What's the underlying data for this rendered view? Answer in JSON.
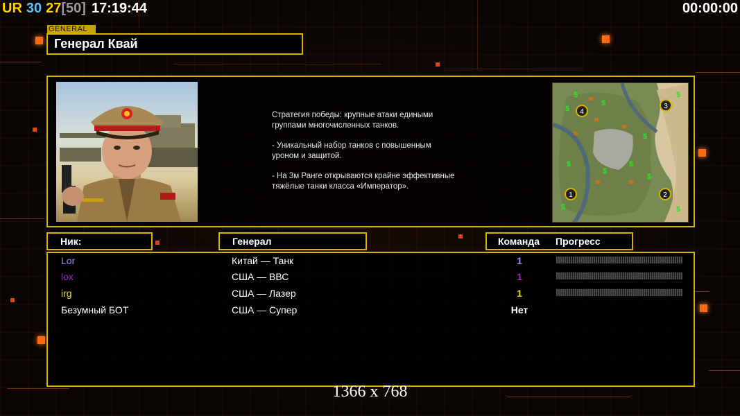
{
  "hud": {
    "ur_label": "UR",
    "stat1": "30",
    "stat2": "27",
    "stat3": "[50]",
    "clock": "17:19:44",
    "timer": "00:00:00"
  },
  "header": {
    "tag": "GENERAL",
    "title": "Генерал Квай"
  },
  "info": {
    "description": "Стратегия победы: крупные атаки едиными\n группами многочисленных танков.\n\n- Уникальный набор танков с повышенным\n уроном и защитой.\n\n- На 3м Ранге открываются крайне эффективные\n тяжёлые танки класса «Император».",
    "minimap_slots": [
      "1",
      "2",
      "3",
      "4"
    ]
  },
  "columns": {
    "nick": "Ник:",
    "general": "Генерал",
    "team": "Команда",
    "progress": "Прогресс"
  },
  "players": [
    {
      "nick": "Lor",
      "general": "Китай — Танк",
      "team": "1",
      "color": "#8c8cff",
      "team_color": "#8c8cff",
      "progress": 0
    },
    {
      "nick": "lox",
      "general": "США — ВВС",
      "team": "1",
      "color": "#a020d0",
      "team_color": "#a020d0",
      "progress": 0
    },
    {
      "nick": "irg",
      "general": "США — Лазер",
      "team": "1",
      "color": "#d9d91a",
      "team_color": "#d9d91a",
      "progress": 0
    },
    {
      "nick": "Безумный БОТ",
      "general": "США — Супер",
      "team": "Нет",
      "color": "#ffffff",
      "team_color": "#ffffff",
      "progress": null
    }
  ],
  "footer": {
    "resolution": "1366 x 768"
  },
  "colors": {
    "frame": "#d6b300",
    "accent": "#ff6a10"
  }
}
